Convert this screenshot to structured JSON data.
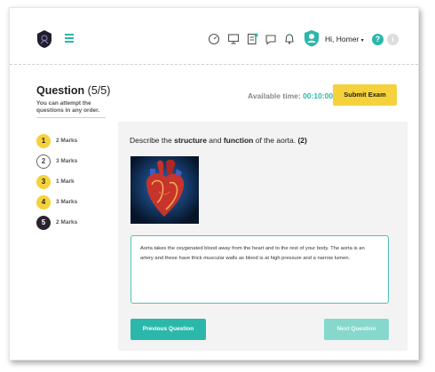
{
  "header": {
    "greeting": "Hi, Homer",
    "help_label": "?",
    "info_label": "i"
  },
  "question": {
    "title": "Question",
    "count": "(5/5)",
    "hint": "You can attempt the questions in any order.",
    "text_before": "Describe the ",
    "text_bold1": "structure",
    "text_mid": " and ",
    "text_bold2": "function",
    "text_after": " of the aorta. ",
    "marks_label": "(2)",
    "answer": "Aorta takes the oxygenated blood away from the heart and to the rest of your body. The aorta is an artery and these have thick muscular walls as blood is at high pressure and a narrow lumen."
  },
  "timer": {
    "label": "Available time:",
    "value": "00:10:00"
  },
  "buttons": {
    "submit": "Submit Exam",
    "previous": "Previous Question",
    "next": "Next Question"
  },
  "questions": [
    {
      "number": "1",
      "marks": "2 Marks",
      "state": "answered"
    },
    {
      "number": "2",
      "marks": "3 Marks",
      "state": "empty"
    },
    {
      "number": "3",
      "marks": "1 Mark",
      "state": "answered"
    },
    {
      "number": "4",
      "marks": "3 Marks",
      "state": "answered"
    },
    {
      "number": "5",
      "marks": "2 Marks",
      "state": "current"
    }
  ],
  "colors": {
    "accent": "#2bb8aa",
    "submit": "#f5d23b",
    "current": "#2a2230"
  },
  "icons": [
    "shield-logo-icon",
    "menu-icon",
    "dashboard-gauge-icon",
    "monitor-icon",
    "notebook-icon",
    "chat-icon",
    "bell-icon",
    "avatar-icon",
    "help-icon",
    "info-icon"
  ]
}
